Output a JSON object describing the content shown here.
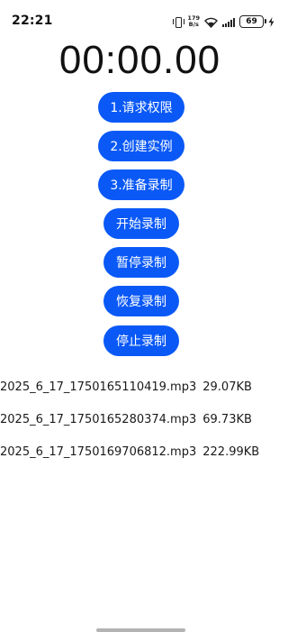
{
  "status_bar": {
    "time": "22:21",
    "net_speed_value": "179",
    "net_speed_unit": "B/s",
    "battery_level": "69",
    "icons": [
      "vibrate-icon",
      "wifi-icon",
      "signal-icon",
      "battery-icon",
      "charging-bolt-icon"
    ]
  },
  "timer": {
    "display": "00:00.00"
  },
  "buttons": {
    "request_permission": "1.请求权限",
    "create_instance": "2.创建实例",
    "prepare_recording": "3.准备录制",
    "start_recording": "开始录制",
    "pause_recording": "暂停录制",
    "resume_recording": "恢复录制",
    "stop_recording": "停止录制"
  },
  "files": [
    {
      "name": "2025_6_17_1750165110419.mp3",
      "size": "29.07KB"
    },
    {
      "name": "2025_6_17_1750165280374.mp3",
      "size": "69.73KB"
    },
    {
      "name": "2025_6_17_1750169706812.mp3",
      "size": "222.99KB"
    }
  ],
  "colors": {
    "accent": "#0a59f7",
    "button_text": "#ffffff",
    "background": "#ffffff",
    "text": "#111111"
  }
}
